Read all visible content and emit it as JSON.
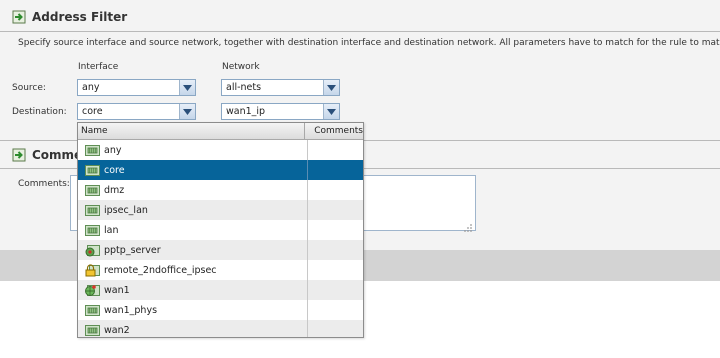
{
  "address_filter": {
    "title": "Address Filter",
    "description": "Specify source interface and source network, together with destination interface and destination network. All parameters have to match for the rule to match.",
    "col_interface": "Interface",
    "col_network": "Network",
    "source_label": "Source:",
    "destination_label": "Destination:",
    "source_interface": "any",
    "source_network": "all-nets",
    "destination_interface": "core",
    "destination_network": "wan1_ip"
  },
  "comments": {
    "title": "Comme",
    "label": "Comments:",
    "value": ""
  },
  "dropdown": {
    "col_name": "Name",
    "col_comments": "Comments",
    "selected": "core",
    "items": [
      {
        "name": "any",
        "icon": "interface-icon"
      },
      {
        "name": "core",
        "icon": "interface-icon"
      },
      {
        "name": "dmz",
        "icon": "interface-icon"
      },
      {
        "name": "ipsec_lan",
        "icon": "interface-icon"
      },
      {
        "name": "lan",
        "icon": "interface-icon"
      },
      {
        "name": "pptp_server",
        "icon": "pptp-interface-icon"
      },
      {
        "name": "remote_2ndoffice_ipsec",
        "icon": "ipsec-tunnel-icon"
      },
      {
        "name": "wan1",
        "icon": "wan-interface-icon"
      },
      {
        "name": "wan1_phys",
        "icon": "interface-icon"
      },
      {
        "name": "wan2",
        "icon": "interface-icon"
      }
    ]
  },
  "colors": {
    "selection": "#06649a",
    "combo_border": "#8aa7c4"
  }
}
